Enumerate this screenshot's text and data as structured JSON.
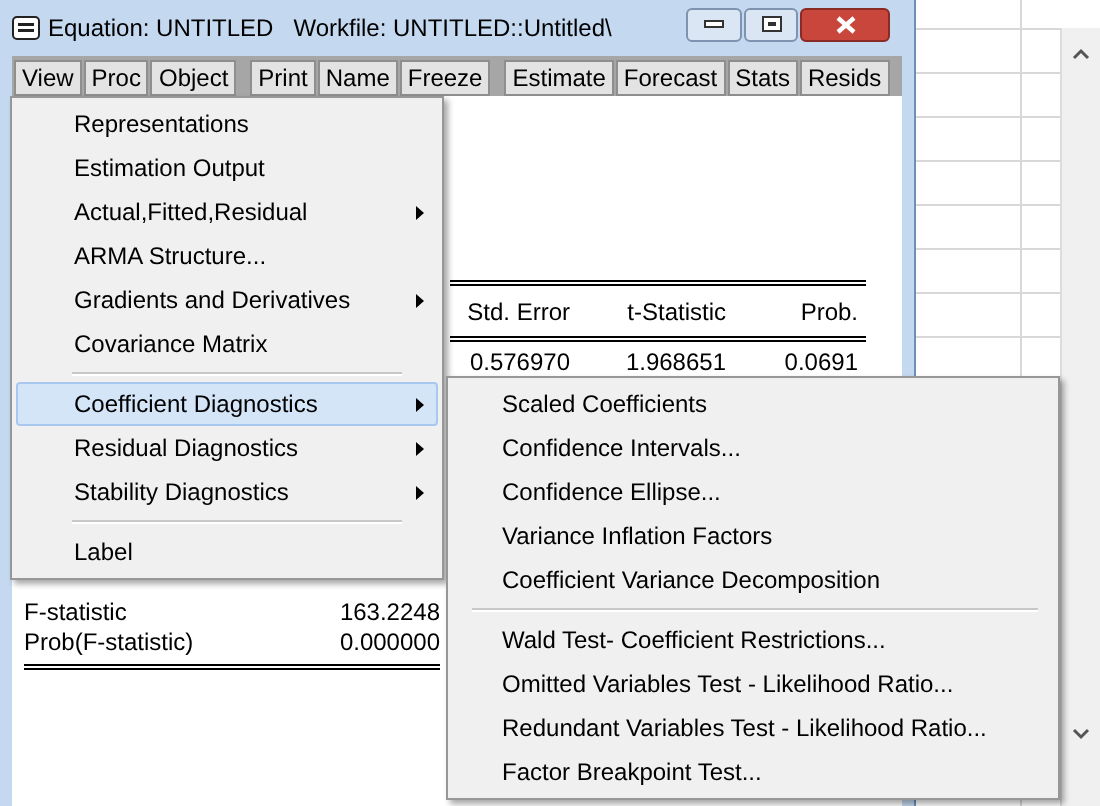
{
  "window": {
    "title": "Equation: UNTITLED",
    "workfile": "Workfile: UNTITLED::Untitled\\"
  },
  "toolbar": [
    [
      "View",
      "Proc",
      "Object"
    ],
    [
      "Print",
      "Name",
      "Freeze"
    ],
    [
      "Estimate",
      "Forecast",
      "Stats",
      "Resids"
    ]
  ],
  "table": {
    "columns": [
      "Std. Error",
      "t-Statistic",
      "Prob."
    ],
    "row": [
      "0.576970",
      "1.968651",
      "0.0691"
    ]
  },
  "stats": [
    {
      "label": "F-statistic",
      "value": "163.2248"
    },
    {
      "label": "Prob(F-statistic)",
      "value": "0.000000"
    }
  ],
  "menu": [
    {
      "kind": "item",
      "label": "Representations",
      "submenu": false,
      "selected": false
    },
    {
      "kind": "item",
      "label": "Estimation Output",
      "submenu": false,
      "selected": false
    },
    {
      "kind": "item",
      "label": "Actual,Fitted,Residual",
      "submenu": true,
      "selected": false
    },
    {
      "kind": "item",
      "label": "ARMA Structure...",
      "submenu": false,
      "selected": false
    },
    {
      "kind": "item",
      "label": "Gradients and Derivatives",
      "submenu": true,
      "selected": false
    },
    {
      "kind": "item",
      "label": "Covariance Matrix",
      "submenu": false,
      "selected": false
    },
    {
      "kind": "separator"
    },
    {
      "kind": "item",
      "label": "Coefficient Diagnostics",
      "submenu": true,
      "selected": true
    },
    {
      "kind": "item",
      "label": "Residual Diagnostics",
      "submenu": true,
      "selected": false
    },
    {
      "kind": "item",
      "label": "Stability Diagnostics",
      "submenu": true,
      "selected": false
    },
    {
      "kind": "separator"
    },
    {
      "kind": "item",
      "label": "Label",
      "submenu": false,
      "selected": false
    }
  ],
  "submenu": [
    {
      "kind": "item",
      "label": "Scaled Coefficients"
    },
    {
      "kind": "item",
      "label": "Confidence Intervals..."
    },
    {
      "kind": "item",
      "label": "Confidence Ellipse..."
    },
    {
      "kind": "item",
      "label": "Variance Inflation Factors"
    },
    {
      "kind": "item",
      "label": "Coefficient Variance Decomposition"
    },
    {
      "kind": "separator"
    },
    {
      "kind": "item",
      "label": "Wald Test- Coefficient Restrictions..."
    },
    {
      "kind": "item",
      "label": "Omitted Variables Test - Likelihood Ratio..."
    },
    {
      "kind": "item",
      "label": "Redundant Variables Test - Likelihood Ratio..."
    },
    {
      "kind": "item",
      "label": "Factor Breakpoint Test..."
    }
  ]
}
